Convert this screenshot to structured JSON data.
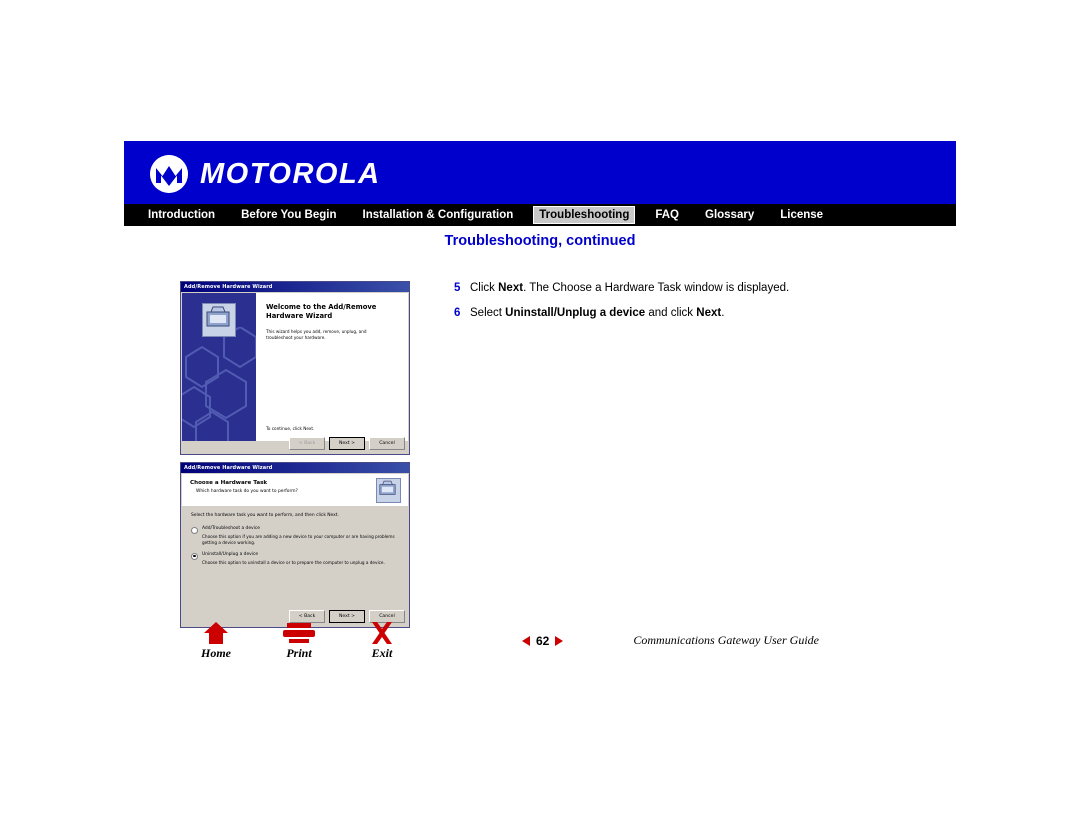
{
  "header": {
    "brand": "MOTOROLA",
    "logo_icon": "motorola-m-logo"
  },
  "nav": {
    "items": [
      {
        "label": "Introduction",
        "active": false
      },
      {
        "label": "Before You Begin",
        "active": false
      },
      {
        "label": "Installation & Configuration",
        "active": false
      },
      {
        "label": "Troubleshooting",
        "active": true
      },
      {
        "label": "FAQ",
        "active": false
      },
      {
        "label": "Glossary",
        "active": false
      },
      {
        "label": "License",
        "active": false
      }
    ]
  },
  "page_title": "Troubleshooting, continued",
  "steps": [
    {
      "num": "5",
      "parts": [
        {
          "text": "Click ",
          "bold": false
        },
        {
          "text": "Next",
          "bold": true
        },
        {
          "text": ". The Choose a Hardware Task window is displayed.",
          "bold": false
        }
      ]
    },
    {
      "num": "6",
      "parts": [
        {
          "text": "Select ",
          "bold": false
        },
        {
          "text": "Uninstall/Unplug a device",
          "bold": true
        },
        {
          "text": " and click ",
          "bold": false
        },
        {
          "text": "Next",
          "bold": true
        },
        {
          "text": ".",
          "bold": false
        }
      ]
    }
  ],
  "screenshot_wizard1": {
    "titlebar": "Add/Remove Hardware Wizard",
    "heading_line1": "Welcome to the Add/Remove",
    "heading_line2": "Hardware Wizard",
    "body_text": "This wizard helps you add, remove, unplug, and troubleshoot your hardware.",
    "continue_text": "To continue, click Next.",
    "buttons": [
      {
        "label": "< Back",
        "state": "disabled"
      },
      {
        "label": "Next >",
        "state": "default"
      },
      {
        "label": "Cancel",
        "state": "normal"
      }
    ]
  },
  "screenshot_wizard2": {
    "titlebar": "Add/Remove Hardware Wizard",
    "head_title": "Choose a Hardware Task",
    "head_sub": "Which hardware task do you want to perform?",
    "lead": "Select the hardware task you want to perform, and then click Next.",
    "options": [
      {
        "title": "Add/Troubleshoot a device",
        "desc": "Choose this option if you are adding a new device to your computer or are having problems getting a device working.",
        "selected": false
      },
      {
        "title": "Uninstall/Unplug a device",
        "desc": "Choose this option to uninstall a device or to prepare the computer to unplug a device.",
        "selected": true
      }
    ],
    "buttons": [
      {
        "label": "< Back",
        "state": "normal"
      },
      {
        "label": "Next >",
        "state": "default"
      },
      {
        "label": "Cancel",
        "state": "normal"
      }
    ]
  },
  "footer_icons": [
    {
      "label": "Home",
      "icon": "home-icon"
    },
    {
      "label": "Print",
      "icon": "printer-icon"
    },
    {
      "label": "Exit",
      "icon": "exit-x-icon"
    }
  ],
  "footer": {
    "page_number": "62",
    "guide_text": "Communications Gateway User Guide",
    "prev_icon": "prev-page-arrow",
    "next_icon": "next-page-arrow"
  },
  "colors": {
    "brand_blue": "#0000cc",
    "accent_red": "#cc0000",
    "nav_black": "#000000"
  }
}
